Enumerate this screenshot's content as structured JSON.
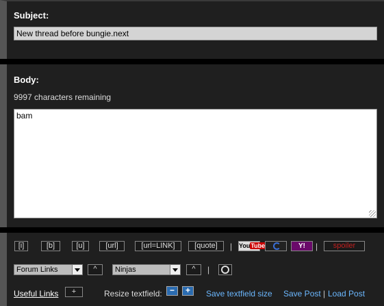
{
  "subject": {
    "label": "Subject:",
    "value": "New thread before bungie.next"
  },
  "body": {
    "label": "Body:",
    "remaining": "9997 characters remaining",
    "value": "bam"
  },
  "toolbar": {
    "format_buttons": [
      "[i]",
      "[b]",
      "[u]",
      "[url]",
      "[url=LINK]",
      "[quote]"
    ],
    "separator": "|",
    "youtube": {
      "you": "You",
      "tube": "Tube"
    },
    "yahoo": "Y!",
    "spoiler": "spoiler",
    "forum_links_select": "Forum Links",
    "caret1": "^",
    "ninjas_select": "Ninjas",
    "caret2": "^",
    "useful_links": "Useful Links",
    "plus": "+",
    "resize_label": "Resize textfield:",
    "minus_btn": "−",
    "plus_btn": "+",
    "save_size": "Save textfield size",
    "save_post": "Save Post",
    "load_post": "Load Post",
    "link_sep": "|"
  },
  "colors": {
    "panel": "#1f1f1f",
    "link": "#6cb8ff",
    "spoiler": "#c21e1e"
  }
}
